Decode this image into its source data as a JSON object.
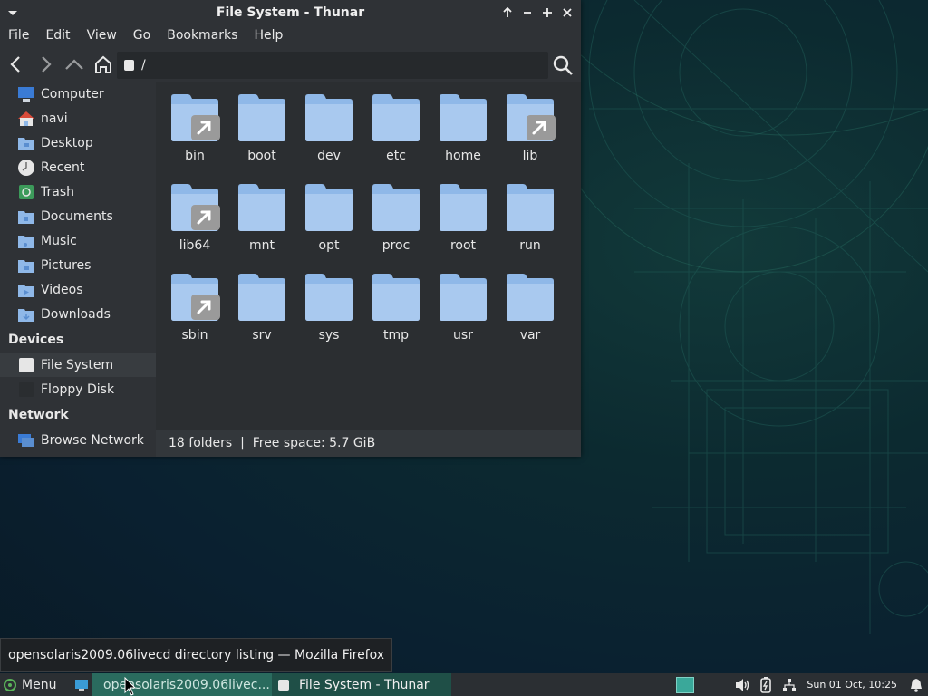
{
  "window": {
    "title": "File System - Thunar",
    "menu": [
      "File",
      "Edit",
      "View",
      "Go",
      "Bookmarks",
      "Help"
    ],
    "location": "/",
    "sidebar": {
      "places": [
        {
          "label": "Computer",
          "icon": "computer-icon"
        },
        {
          "label": "navi",
          "icon": "home-icon"
        },
        {
          "label": "Desktop",
          "icon": "desktop-folder-icon"
        },
        {
          "label": "Recent",
          "icon": "clock-icon"
        },
        {
          "label": "Trash",
          "icon": "trash-icon"
        },
        {
          "label": "Documents",
          "icon": "documents-folder-icon"
        },
        {
          "label": "Music",
          "icon": "music-folder-icon"
        },
        {
          "label": "Pictures",
          "icon": "pictures-folder-icon"
        },
        {
          "label": "Videos",
          "icon": "videos-folder-icon"
        },
        {
          "label": "Downloads",
          "icon": "downloads-folder-icon"
        }
      ],
      "devices_heading": "Devices",
      "devices": [
        {
          "label": "File System",
          "icon": "drive-icon"
        },
        {
          "label": "Floppy Disk",
          "icon": "floppy-icon"
        }
      ],
      "network_heading": "Network",
      "network": [
        {
          "label": "Browse Network",
          "icon": "network-icon"
        }
      ]
    },
    "folders": [
      {
        "name": "bin",
        "link": true
      },
      {
        "name": "boot",
        "link": false
      },
      {
        "name": "dev",
        "link": false
      },
      {
        "name": "etc",
        "link": false
      },
      {
        "name": "home",
        "link": false
      },
      {
        "name": "lib",
        "link": true
      },
      {
        "name": "lib64",
        "link": true
      },
      {
        "name": "mnt",
        "link": false
      },
      {
        "name": "opt",
        "link": false
      },
      {
        "name": "proc",
        "link": false
      },
      {
        "name": "root",
        "link": false
      },
      {
        "name": "run",
        "link": false
      },
      {
        "name": "sbin",
        "link": true
      },
      {
        "name": "srv",
        "link": false
      },
      {
        "name": "sys",
        "link": false
      },
      {
        "name": "tmp",
        "link": false
      },
      {
        "name": "usr",
        "link": false
      },
      {
        "name": "var",
        "link": false
      }
    ],
    "status": "18 folders  |  Free space: 5.7 GiB"
  },
  "tooltip": "opensolaris2009.06livecd directory listing — Mozilla Firefox",
  "taskbar": {
    "menu_label": "Menu",
    "tasks": [
      {
        "label": "opensolaris2009.06livec...",
        "icon": "firefox-icon"
      },
      {
        "label": "File System - Thunar",
        "icon": "drive-icon"
      }
    ],
    "clock": "Sun 01 Oct, 10:25"
  },
  "colors": {
    "folder": "#8fb8e8",
    "folder_tab": "#a9c9ef",
    "accent": "#2a6b5e"
  }
}
